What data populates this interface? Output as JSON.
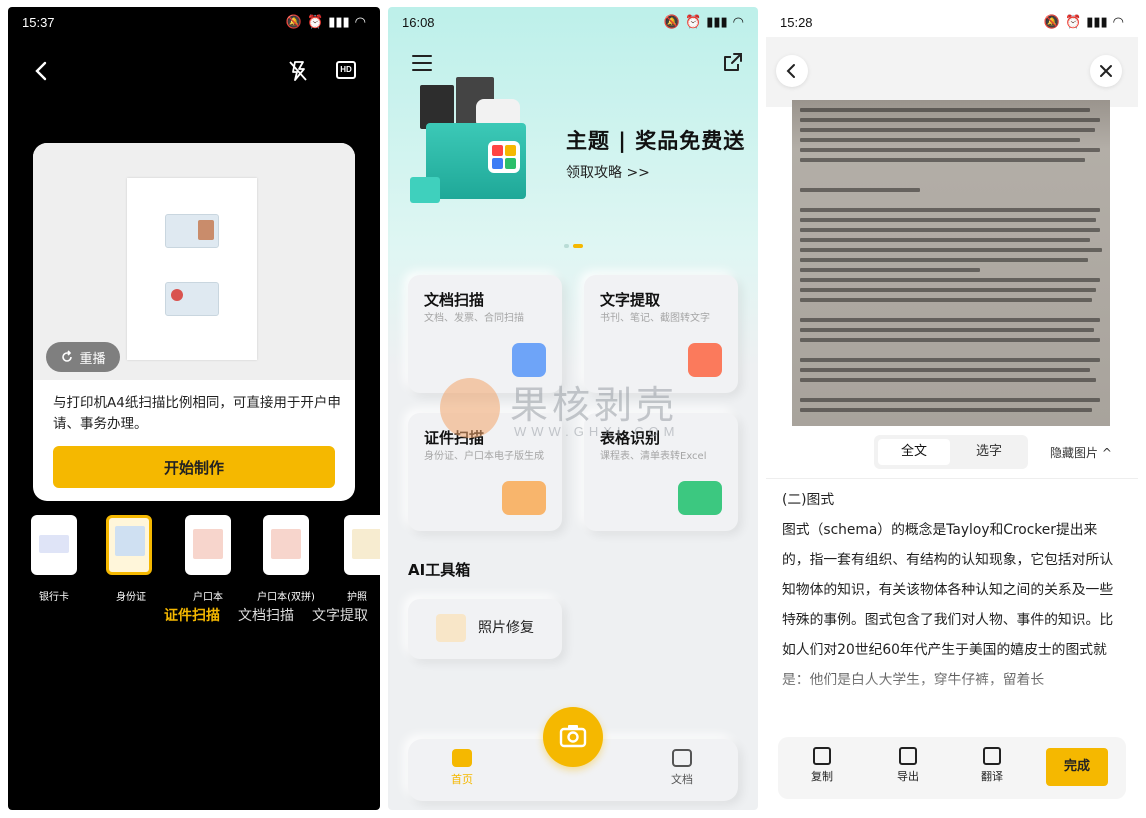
{
  "panel_scan": {
    "status_time": "15:37",
    "retake_label": "重播",
    "description": "与打印机A4纸扫描比例相同，可直接用于开户申请、事务办理。",
    "start_button": "开始制作",
    "doc_types": [
      {
        "label": "银行卡"
      },
      {
        "label": "身份证"
      },
      {
        "label": "户口本"
      },
      {
        "label": "户口本(双拼)"
      },
      {
        "label": "护照"
      }
    ],
    "modes": [
      "证件扫描",
      "文档扫描",
      "文字提取"
    ],
    "hd_label": "HD"
  },
  "panel_home": {
    "status_time": "16:08",
    "banner_title": "主题 | 奖品免费送",
    "banner_sub": "领取攻略 >>",
    "tiles": [
      {
        "title": "文档扫描",
        "sub": "文档、发票、合同扫描"
      },
      {
        "title": "文字提取",
        "sub": "书刊、笔记、截图转文字"
      },
      {
        "title": "证件扫描",
        "sub": "身份证、户口本电子版生成"
      },
      {
        "title": "表格识别",
        "sub": "课程表、清单表转Excel"
      }
    ],
    "ai_section": "AI工具箱",
    "ai_tool": "照片修复",
    "tabs": {
      "home": "首页",
      "docs": "文档"
    },
    "colors": {
      "accent": "#f5b800"
    }
  },
  "watermark": {
    "big": "果核剥壳",
    "small": "WWW.GHXI.COM"
  },
  "panel_ocr": {
    "status_time": "15:28",
    "seg_full": "全文",
    "seg_select": "选字",
    "hide_image": "隐藏图片 ^",
    "text_heading": "(二)图式",
    "text_body": "图式（schema）的概念是Tayloy和Crocker提出来的，指一套有组织、有结构的认知现象，它包括对所认知物体的知识，有关该物体各种认知之间的关系及一些特殊的事例。图式包含了我们对人物、事件的知识。比如人们对20世纪60年代产生于美国的嬉皮士的图式就是：他们是白人大学生，穿牛仔裤，留着长",
    "actions": [
      "复制",
      "导出",
      "翻译"
    ],
    "done": "完成"
  }
}
